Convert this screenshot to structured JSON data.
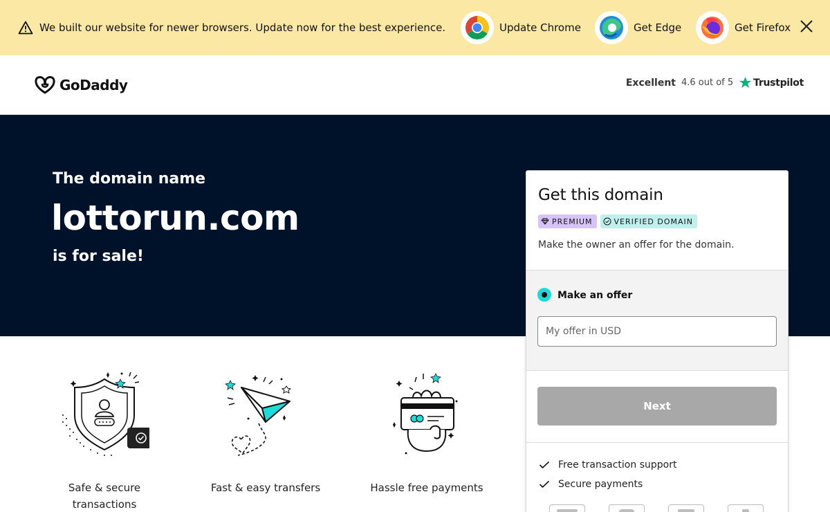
{
  "banner": {
    "message": "We built our website for newer browsers. Update now for the best experience.",
    "icon": "warning-icon",
    "browsers": [
      {
        "label": "Update Chrome",
        "icon": "chrome-logo-icon"
      },
      {
        "label": "Get Edge",
        "icon": "edge-logo-icon"
      },
      {
        "label": "Get Firefox",
        "icon": "firefox-logo-icon"
      }
    ],
    "close_icon": "close-icon"
  },
  "header": {
    "brand": "GoDaddy",
    "rating_word": "Excellent",
    "rating_score": "4.6 out of 5",
    "rating_source": "Trustpilot",
    "trustpilot_color": "#00b67a"
  },
  "hero": {
    "eyebrow": "The domain name",
    "domain": "lottorun.com",
    "suffix": "is for sale!",
    "background": "#001229"
  },
  "features": [
    {
      "caption": "Safe & secure transactions",
      "icon": "shield-user-icon"
    },
    {
      "caption": "Fast & easy transfers",
      "icon": "paper-plane-icon"
    },
    {
      "caption": "Hassle free payments",
      "icon": "card-payment-icon"
    }
  ],
  "card": {
    "title": "Get this domain",
    "badges": [
      {
        "label": "PREMIUM",
        "icon": "diamond-icon",
        "color": "#d7c4f7"
      },
      {
        "label": "VERIFIED DOMAIN",
        "icon": "check-circle-icon",
        "color": "#bff0ee"
      }
    ],
    "description": "Make the owner an offer for the domain.",
    "option_label": "Make an offer",
    "input_placeholder": "My offer in USD",
    "next_label": "Next",
    "perks": [
      "Free transaction support",
      "Secure payments"
    ],
    "accent": "#1bdbdb"
  }
}
